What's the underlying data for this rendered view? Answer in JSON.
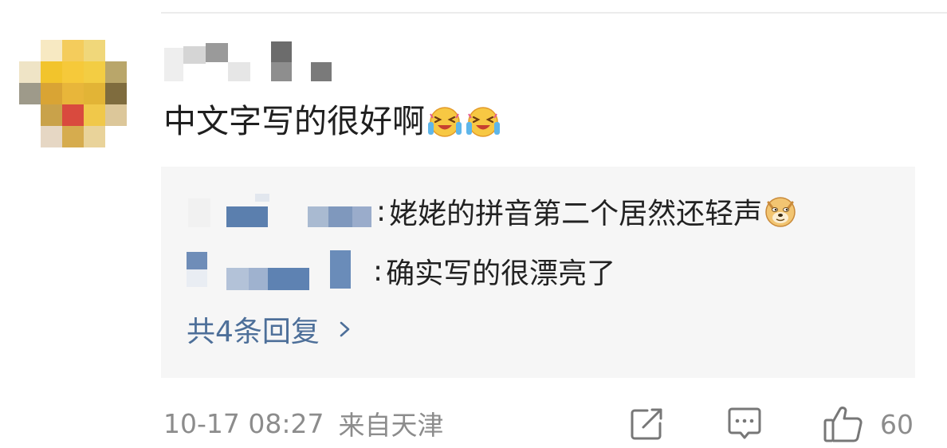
{
  "comment": {
    "text": "中文字写的很好啊",
    "emoji_icons": [
      "laughing-crying-emoji",
      "laughing-crying-emoji"
    ]
  },
  "replies": [
    {
      "text": "姥姥的拼音第二个居然还轻声",
      "emoji_icon": "doge-emoji"
    },
    {
      "text": "确实写的很漂亮了"
    }
  ],
  "view_replies_label": "共4条回复",
  "meta": {
    "time": "10-17 08:27",
    "location": "来自天津"
  },
  "actions": {
    "like_count": "60",
    "icons": [
      "share-icon",
      "comment-icon",
      "like-icon",
      "chevron-right-icon"
    ]
  },
  "colors": {
    "link_blue": "#4d6f99",
    "meta_gray": "#8c8c8c",
    "reply_bg": "#f6f6f6"
  }
}
